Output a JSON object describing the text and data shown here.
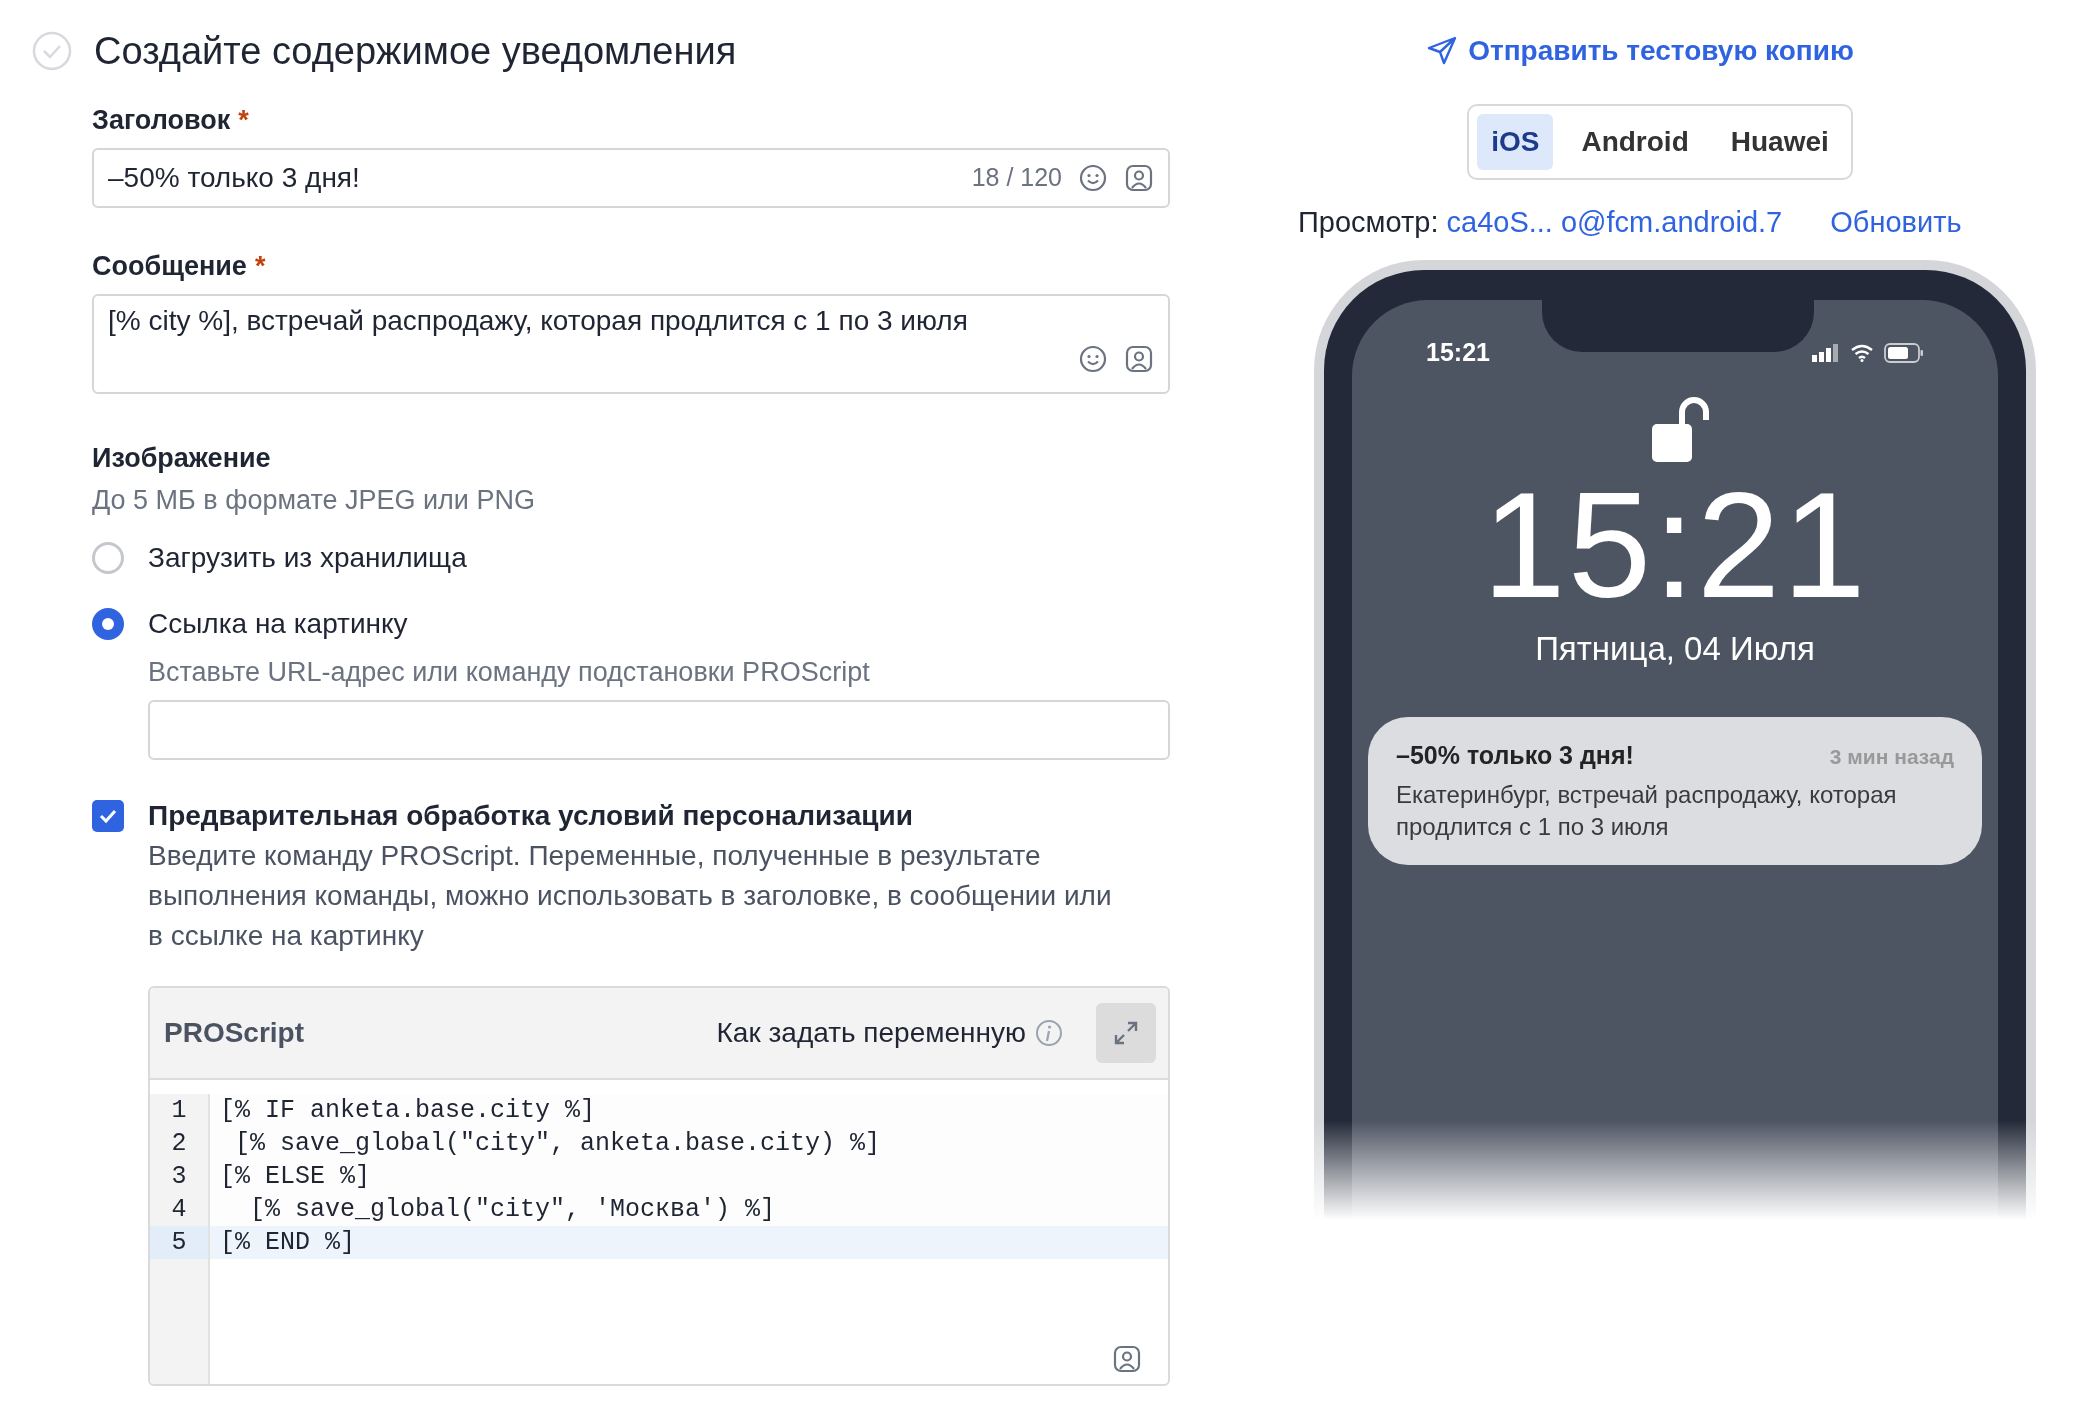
{
  "section": {
    "title": "Создайте содержимое уведомления"
  },
  "title_field": {
    "label": "Заголовок",
    "required_mark": "*",
    "value": "–50% только 3 дня!",
    "counter": "18 / 120"
  },
  "message_field": {
    "label": "Сообщение",
    "required_mark": "*",
    "value": "[% city %], встречай распродажу, которая продлится с 1 по 3 июля"
  },
  "image": {
    "label": "Изображение",
    "hint": "До 5 МБ в формате JPEG или PNG",
    "options": [
      {
        "label": "Загрузить из хранилища",
        "selected": false
      },
      {
        "label": "Ссылка на картинку",
        "selected": true
      }
    ],
    "url_hint": "Вставьте URL-адрес или команду подстановки PROScript"
  },
  "preprocess": {
    "label": "Предварительная обработка условий персонализации",
    "checked": true,
    "description": "Введите команду PROScript. Переменные, полученные в результате выполнения команды, можно использовать в заголовке, в сообщении или в ссылке на картинку"
  },
  "editor": {
    "title": "PROScript",
    "help_link": "Как задать переменную",
    "lines": [
      {
        "number": "1",
        "code": "[% IF anketa.base.city %]",
        "selected": false
      },
      {
        "number": "2",
        "code": " [% save_global(\"city\", anketa.base.city) %]",
        "selected": false
      },
      {
        "number": "3",
        "code": "[% ELSE %]",
        "selected": false
      },
      {
        "number": "4",
        "code": "  [% save_global(\"city\", 'Москва') %]",
        "selected": false
      },
      {
        "number": "5",
        "code": "[% END %]",
        "selected": true
      }
    ]
  },
  "preview": {
    "send_test": "Отправить тестовую копию",
    "tabs": [
      {
        "label": "iOS",
        "selected": true
      },
      {
        "label": "Android",
        "selected": false
      },
      {
        "label": "Huawei",
        "selected": false
      }
    ],
    "preview_label": "Просмотр:",
    "device": "ca4oS... o@fcm.android.7",
    "refresh": "Обновить",
    "phone": {
      "status_time": "15:21",
      "clock": "15:21",
      "date": "Пятница, 04 Июля",
      "notification": {
        "title": "–50% только 3 дня!",
        "time": "3 мин назад",
        "body": "Екатеринбург, встречай распродажу, которая продлится с 1 по 3 июля"
      }
    }
  }
}
